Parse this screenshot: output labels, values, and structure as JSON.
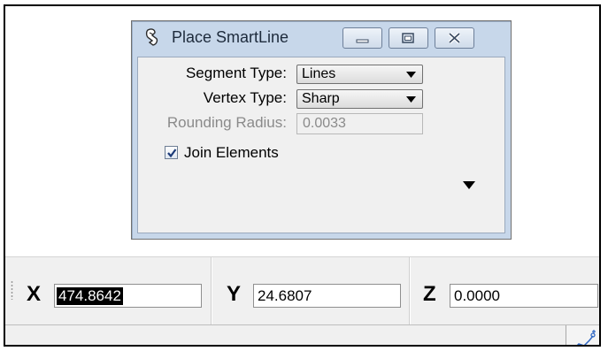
{
  "dialog": {
    "title": "Place SmartLine",
    "icon": "smartline-tool-icon",
    "segment_type": {
      "label": "Segment Type:",
      "value": "Lines"
    },
    "vertex_type": {
      "label": "Vertex Type:",
      "value": "Sharp"
    },
    "rounding_radius": {
      "label": "Rounding Radius:",
      "value": "0.0033"
    },
    "join_elements": {
      "label": "Join Elements",
      "checked": true
    }
  },
  "coordinates": {
    "x_label": "X",
    "x_value": "474.8642",
    "y_label": "Y",
    "y_value": "24.6807",
    "z_label": "Z",
    "z_value": "0.0000"
  }
}
